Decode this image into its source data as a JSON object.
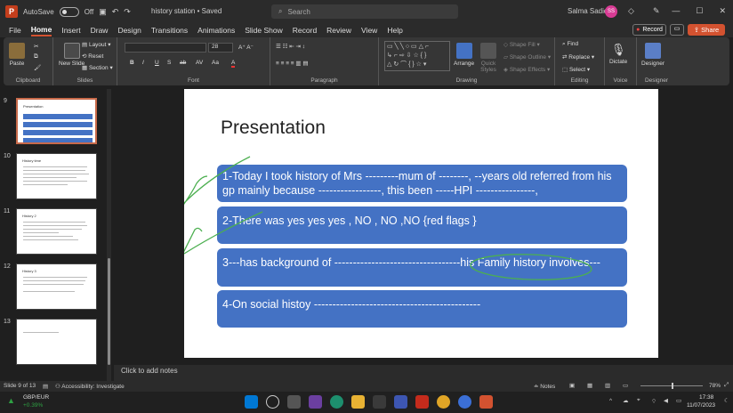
{
  "app": {
    "logo": "P",
    "autosave": "AutoSave",
    "autosave_state": "Off",
    "doc_title": "history station • Saved",
    "search_placeholder": "Search",
    "user_name": "Salma Sadiq",
    "user_initials": "SS"
  },
  "menu": [
    "File",
    "Home",
    "Insert",
    "Draw",
    "Design",
    "Transitions",
    "Animations",
    "Slide Show",
    "Record",
    "Review",
    "View",
    "Help"
  ],
  "menu_active": "Home",
  "top_buttons": {
    "record": "Record",
    "share": "Share"
  },
  "ribbon": {
    "clipboard": {
      "label": "Clipboard",
      "paste": "Paste"
    },
    "slides": {
      "label": "Slides",
      "new_slide": "New Slide",
      "layout": "Layout",
      "reset": "Reset",
      "section": "Section"
    },
    "font": {
      "label": "Font",
      "size": "28",
      "buttons": [
        "B",
        "I",
        "U",
        "S",
        "ab",
        "AV",
        "Aa",
        "A"
      ]
    },
    "paragraph": {
      "label": "Paragraph"
    },
    "drawing": {
      "label": "Drawing",
      "arrange": "Arrange",
      "quick_styles": "Quick Styles",
      "shape_fill": "Shape Fill",
      "shape_outline": "Shape Outline",
      "shape_effects": "Shape Effects"
    },
    "editing": {
      "label": "Editing",
      "find": "Find",
      "replace": "Replace",
      "select": "Select"
    },
    "voice": {
      "label": "Voice",
      "dictate": "Dictate"
    },
    "designer": {
      "label": "Designer",
      "designer": "Designer"
    }
  },
  "thumbnails": [
    {
      "num": "9",
      "title": "Presentation"
    },
    {
      "num": "10",
      "title": "History time"
    },
    {
      "num": "11",
      "title": "History 2"
    },
    {
      "num": "12",
      "title": "History 3"
    },
    {
      "num": "13",
      "title": ""
    }
  ],
  "slide": {
    "title": "Presentation",
    "boxes": [
      "1-Today I took history of Mrs ---------mum of --------, --years old referred from his gp mainly because -----------------, this been -----HPI          ----------------,",
      "2-There was yes yes yes     ,     NO , NO ,NO {red flags }",
      "3---has background of ----------------------------------his Family history  involves---",
      "4-On social histoy ---------------------------------------------"
    ]
  },
  "notes_placeholder": "Click to add notes",
  "status": {
    "slide_info": "Slide 9 of 13",
    "accessibility": "Accessibility: Investigate",
    "notes": "Notes",
    "zoom": "78%"
  },
  "taskbar": {
    "ticker_name": "GBP/EUR",
    "ticker_change": "+0.39%",
    "time": "17:38",
    "date": "11/07/2023"
  },
  "colors": {
    "accent": "#d35230",
    "box": "#4472c4",
    "ink_green": "#4caf50"
  }
}
